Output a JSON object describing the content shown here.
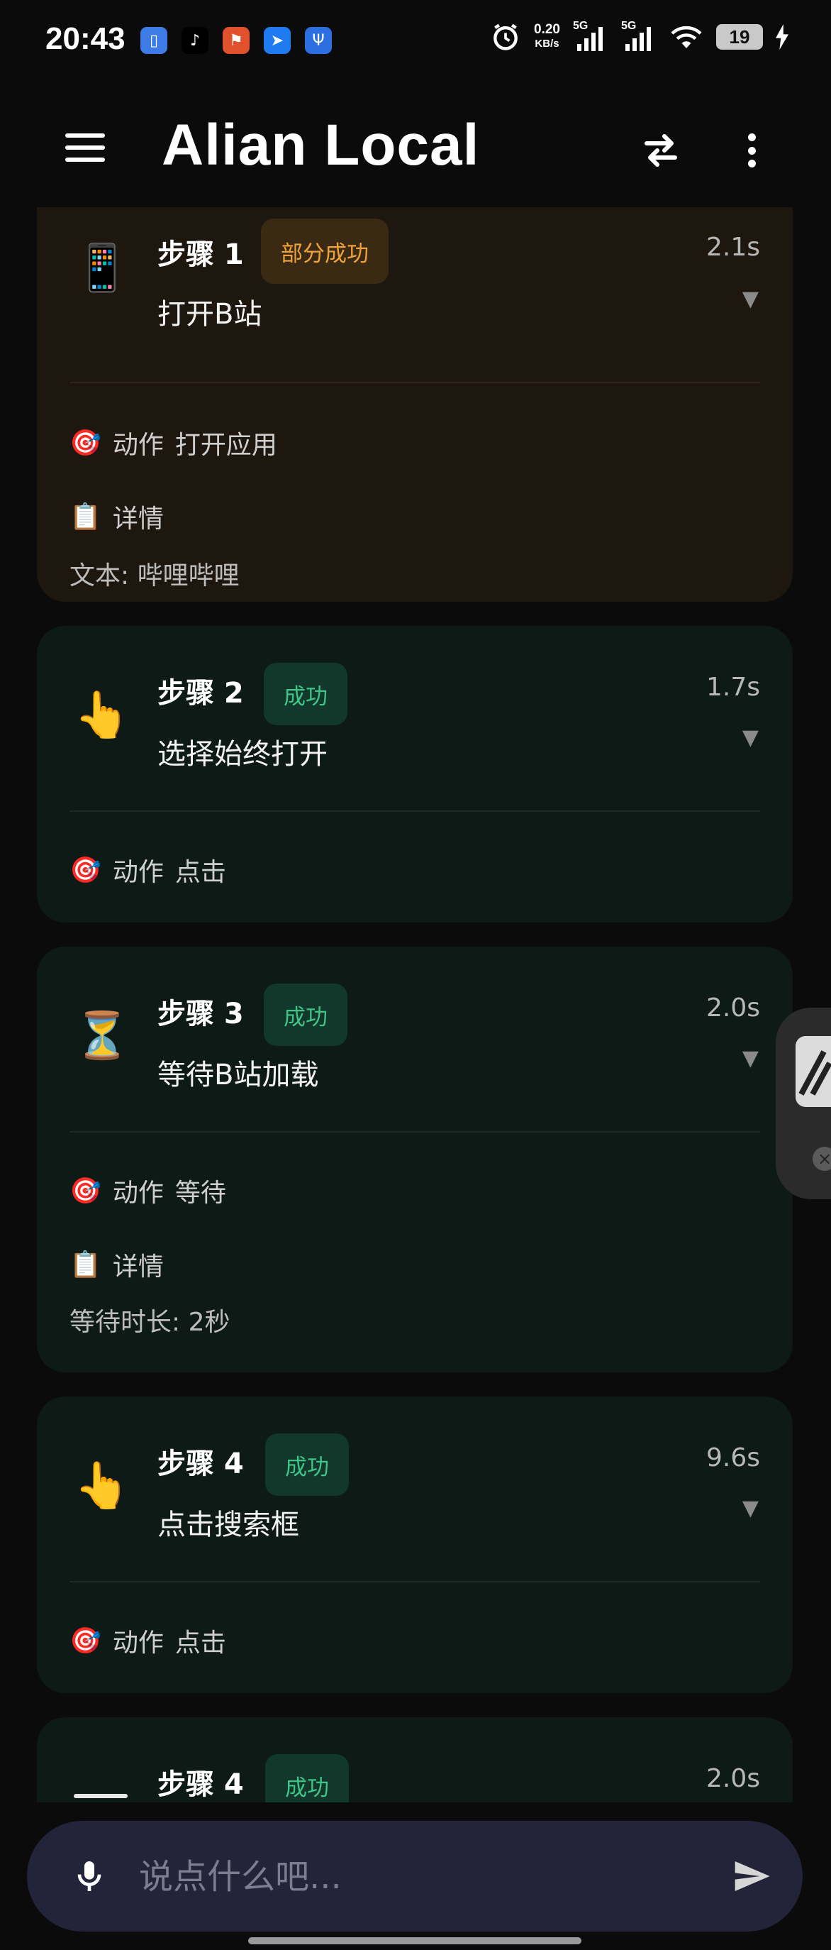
{
  "status_bar": {
    "time": "20:43",
    "net_speed_value": "0.20",
    "net_speed_unit": "KB/s",
    "sim1_label": "5G",
    "sim2_label": "5G",
    "battery": "19",
    "apps": [
      "phone-app-icon",
      "tiktok-icon",
      "game-icon",
      "feishu-icon",
      "usb-icon"
    ]
  },
  "app_bar": {
    "title": "Alian Local"
  },
  "steps": [
    {
      "title": "步骤 1",
      "status": "部分成功",
      "duration": "2.1s",
      "icon": "📱",
      "description": "打开B站",
      "action_label": "动作",
      "action_value": "打开应用",
      "details_label": "详情",
      "details_text": "文本: 哔哩哔哩"
    },
    {
      "title": "步骤 2",
      "status": "成功",
      "duration": "1.7s",
      "icon": "👆",
      "description": "选择始终打开",
      "action_label": "动作",
      "action_value": "点击"
    },
    {
      "title": "步骤 3",
      "status": "成功",
      "duration": "2.0s",
      "icon": "⏳",
      "description": "等待B站加载",
      "action_label": "动作",
      "action_value": "等待",
      "details_label": "详情",
      "details_text": "等待时长: 2秒"
    },
    {
      "title": "步骤 4",
      "status": "成功",
      "duration": "9.6s",
      "icon": "👆",
      "description": "点击搜索框",
      "action_label": "动作",
      "action_value": "点击"
    },
    {
      "title": "步骤 4",
      "status": "成功",
      "duration": "2.0s"
    }
  ],
  "chevron": "▼",
  "action_icon": "🎯",
  "details_icon": "📋",
  "input": {
    "placeholder": "说点什么吧..."
  },
  "colors": {
    "success": "#3fc489",
    "partial": "#f0a23a",
    "card_bg": "#0e1a15",
    "partial_bg": "#1d1710"
  }
}
